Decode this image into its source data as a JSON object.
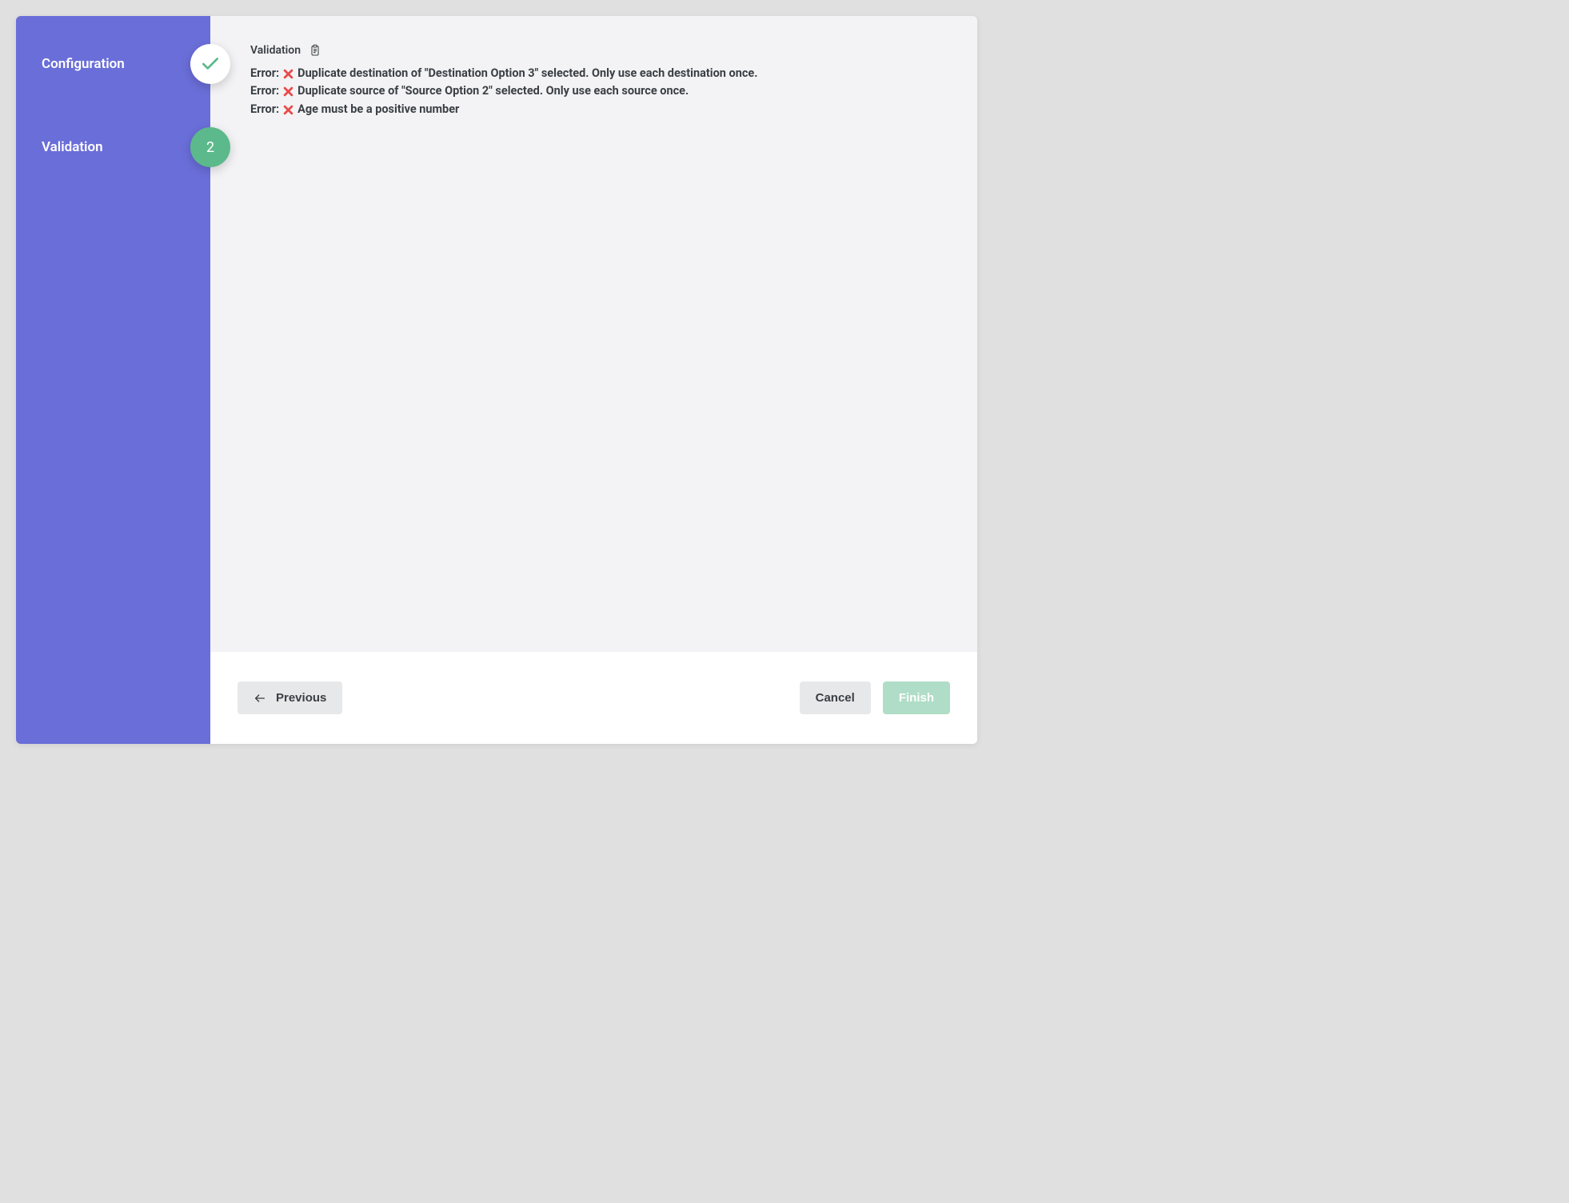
{
  "sidebar": {
    "items": [
      {
        "label": "Configuration",
        "status": "completed"
      },
      {
        "label": "Validation",
        "status": "active",
        "number": "2"
      }
    ]
  },
  "content": {
    "title": "Validation",
    "errors": [
      {
        "prefix": "Error:",
        "message": "Duplicate destination of \"Destination Option 3\" selected. Only use each destination once."
      },
      {
        "prefix": "Error:",
        "message": "Duplicate source of \"Source Option 2\" selected. Only use each source once."
      },
      {
        "prefix": "Error:",
        "message": "Age must be a positive number"
      }
    ]
  },
  "footer": {
    "previous_label": "Previous",
    "cancel_label": "Cancel",
    "finish_label": "Finish"
  }
}
